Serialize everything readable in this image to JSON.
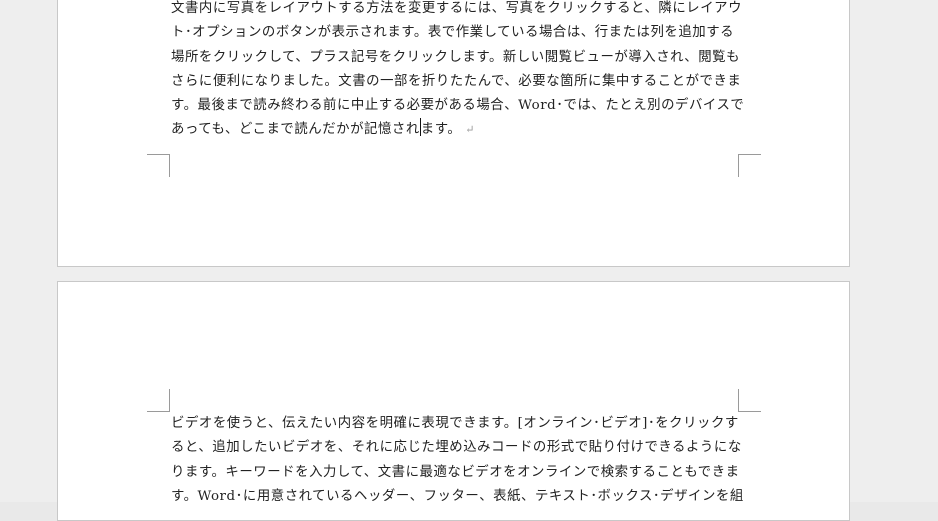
{
  "document": {
    "page1": {
      "lines": [
        "文書内に写真をレイアウトする方法を変更するには、写真をクリックすると、隣にレイアウ",
        "ト･オプションのボタンが表示されます。表で作業している場合は、行または列を追加する",
        "場所をクリックして、プラス記号をクリックします。新しい閲覧ビューが導入され、閲覧も",
        "さらに便利になりました。文書の一部を折りたたんで、必要な箇所に集中することができま",
        "す。最後まで読み終わる前に中止する必要がある場合、Word･では、たとえ別のデバイスで"
      ],
      "last_line_before_caret": "あっても、どこまで読んだかが記憶され",
      "last_line_after_caret": "ます。",
      "paragraph_mark": "↵"
    },
    "page2": {
      "lines": [
        "ビデオを使うと、伝えたい内容を明確に表現できます。[オンライン･ビデオ]･をクリックす",
        "ると、追加したいビデオを、それに応じた埋め込みコードの形式で貼り付けできるようにな",
        "ります。キーワードを入力して、文書に最適なビデオをオンラインで検索することもできま",
        "す。Word･に用意されているヘッダー、フッター、表紙、テキスト･ボックス･デザインを組"
      ]
    }
  }
}
